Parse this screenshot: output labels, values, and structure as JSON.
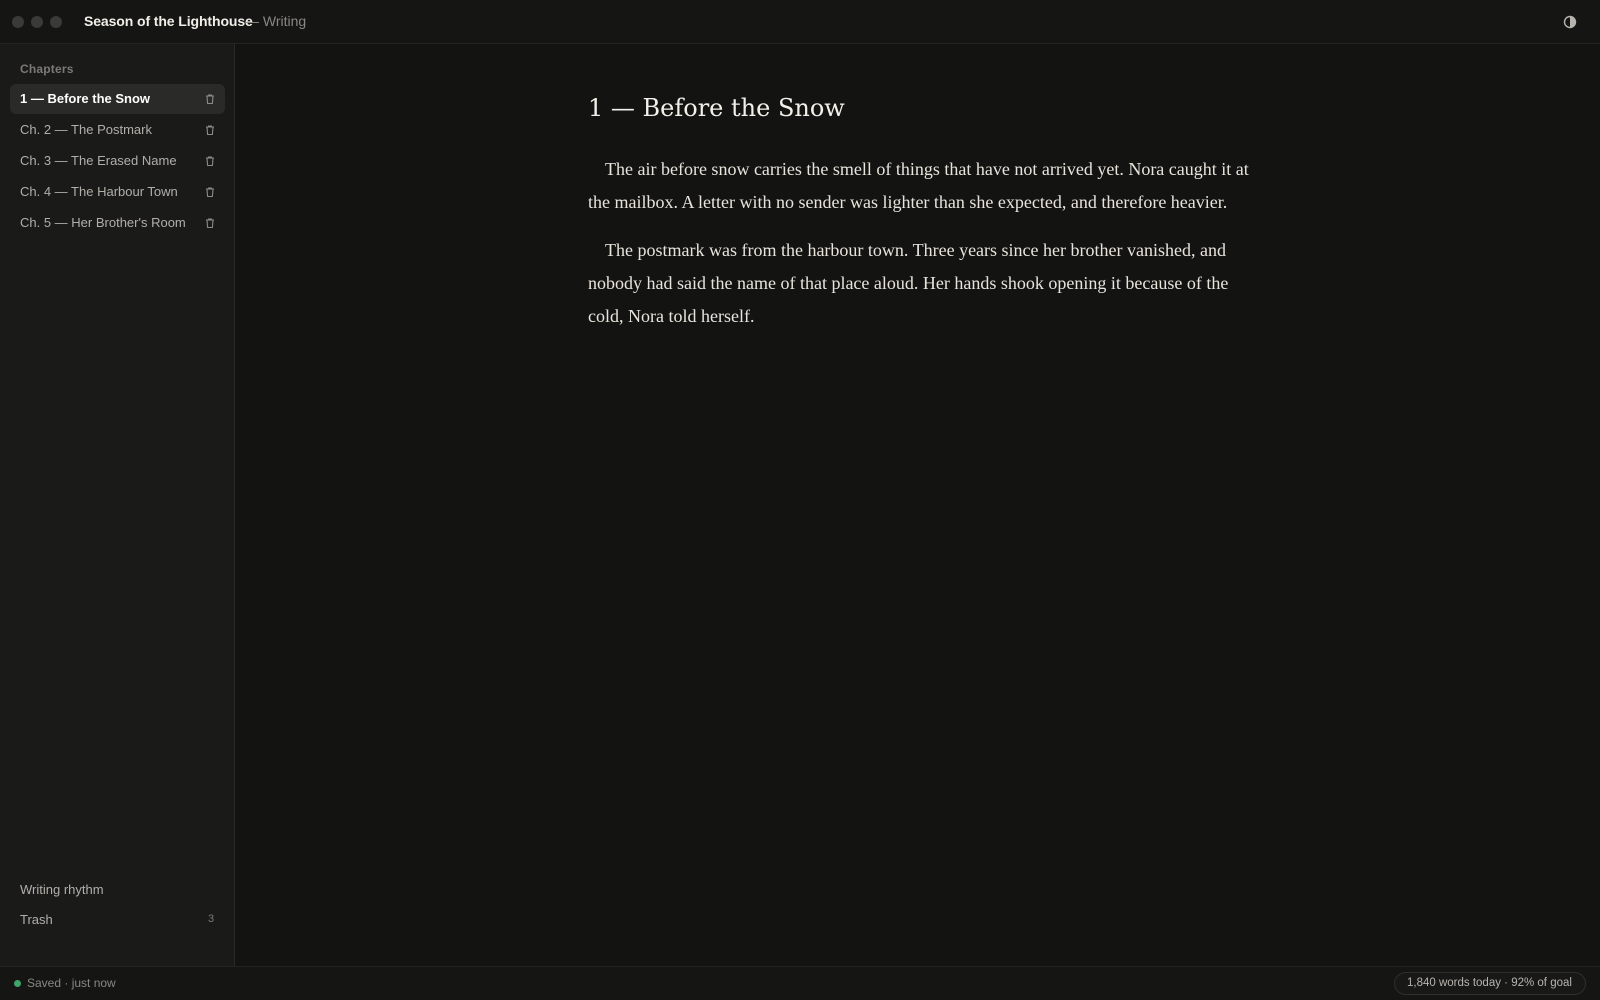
{
  "window": {
    "title": "Season of the Lighthouse",
    "subtitle": "— Writing",
    "theme_toggle_icon": "contrast-icon"
  },
  "sidebar": {
    "heading": "Chapters",
    "chapters": [
      {
        "label": "1 — Before the Snow",
        "active": true
      },
      {
        "label": "Ch. 2 — The Postmark",
        "active": false
      },
      {
        "label": "Ch. 3 — The Erased Name",
        "active": false
      },
      {
        "label": "Ch. 4 — The Harbour Town",
        "active": false
      },
      {
        "label": "Ch. 5 — Her Brother's Room",
        "active": false
      }
    ],
    "writing_rhythm_label": "Writing rhythm",
    "trash_label": "Trash",
    "trash_count": "3"
  },
  "editor": {
    "chapter_title": "1 — Before the Snow",
    "paragraphs": [
      "The air before snow carries the smell of things that have not arrived yet. Nora caught it at the mailbox. A letter with no sender was lighter than she expected, and therefore heavier.",
      "The postmark was from the harbour town. Three years since her brother vanished, and nobody had said the name of that place aloud. Her hands shook opening it because of the cold, Nora told herself."
    ]
  },
  "statusbar": {
    "save_status": "Saved · just now",
    "goal_text": "1,840 words today · 92% of goal"
  },
  "colors": {
    "accent_saved": "#3fa46a",
    "background": "#131312",
    "sidebar_bg": "#1a1a19"
  }
}
